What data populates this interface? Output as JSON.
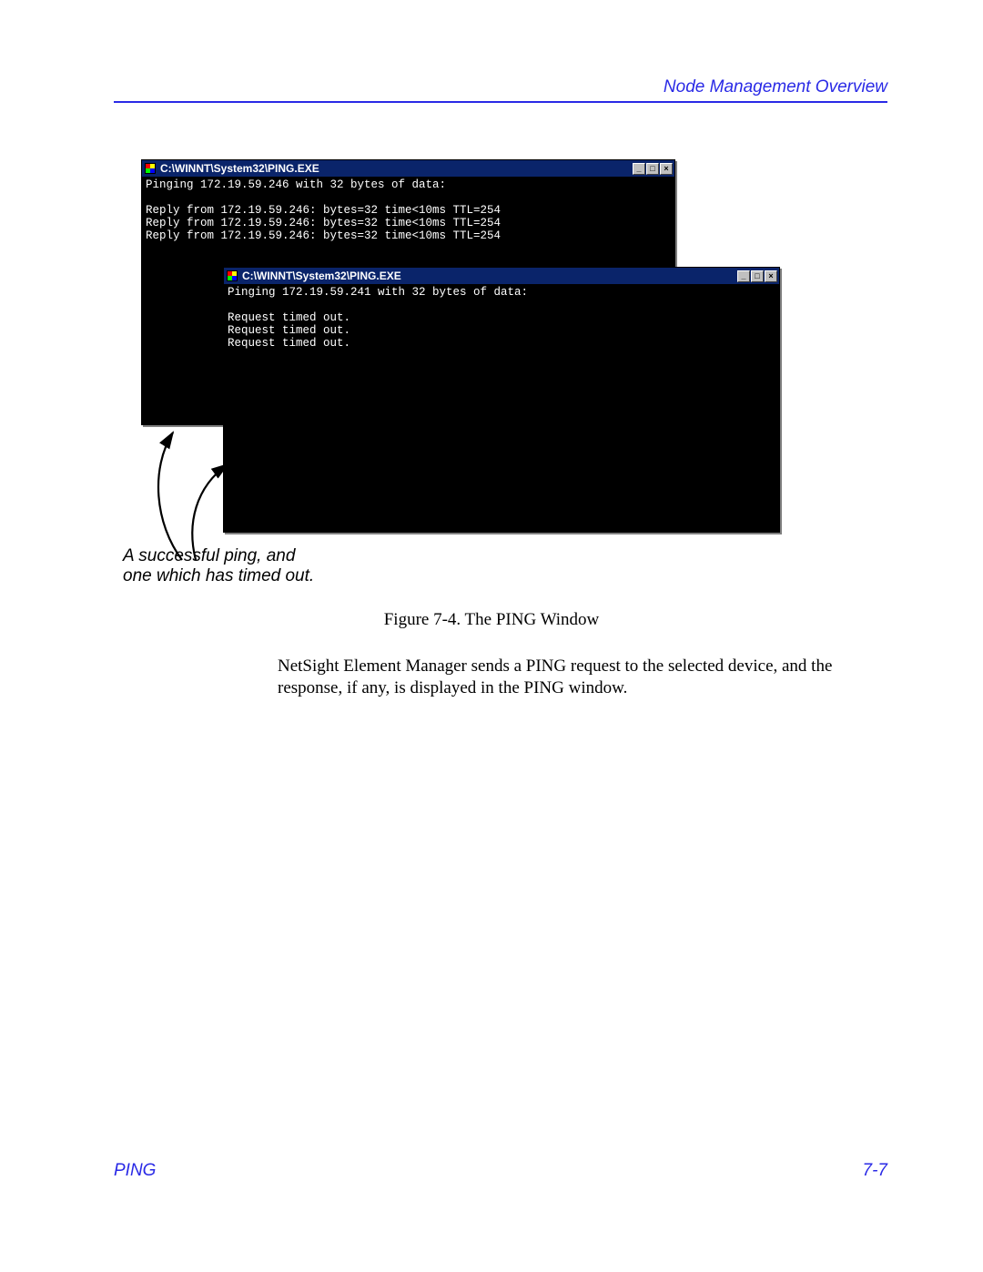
{
  "header": {
    "section_title": "Node Management Overview"
  },
  "figure": {
    "caption_line1": "A successful ping, and",
    "caption_line2": "one which has timed out.",
    "label": "Figure 7-4.  The PING Window"
  },
  "windows": {
    "back": {
      "title": "C:\\WINNT\\System32\\PING.EXE",
      "lines": [
        "Pinging 172.19.59.246 with 32 bytes of data:",
        "",
        "Reply from 172.19.59.246: bytes=32 time<10ms TTL=254",
        "Reply from 172.19.59.246: bytes=32 time<10ms TTL=254",
        "Reply from 172.19.59.246: bytes=32 time<10ms TTL=254"
      ]
    },
    "front": {
      "title": "C:\\WINNT\\System32\\PING.EXE",
      "lines": [
        "Pinging 172.19.59.241 with 32 bytes of data:",
        "",
        "Request timed out.",
        "Request timed out.",
        "Request timed out."
      ]
    },
    "controls": {
      "minimize_glyph": "_",
      "maximize_glyph": "□",
      "close_glyph": "×"
    }
  },
  "body": {
    "paragraph": "NetSight Element Manager sends a PING request to the selected device, and the response, if any, is displayed in the PING window."
  },
  "footer": {
    "left": "PING",
    "right": "7-7"
  }
}
